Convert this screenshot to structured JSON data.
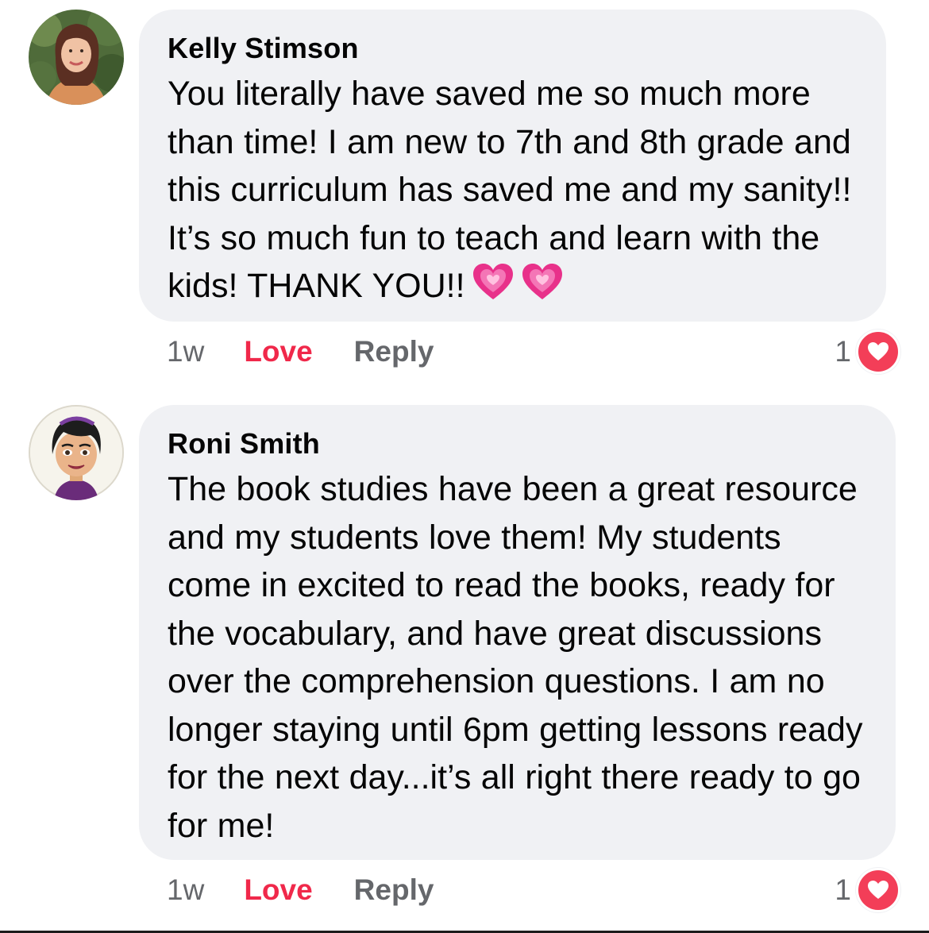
{
  "comments": [
    {
      "author": "Kelly Stimson",
      "text": "You literally have saved me so much more than time! I am new to 7th and 8th grade and this curriculum has saved me and my sanity!! It’s so much fun to teach and learn with the kids! THANK YOU!!",
      "emoji": [
        "growing-heart-icon",
        "growing-heart-icon"
      ],
      "time": "1w",
      "love_label": "Love",
      "reply_label": "Reply",
      "reaction_count": "1",
      "reaction_icon": "heart-icon"
    },
    {
      "author": "Roni Smith",
      "text": "The book studies have been a great resource and my students love them! My students come in excited to read the books, ready for the vocabulary, and have great discussions over the comprehension questions. I am no longer staying until 6pm getting lessons ready for the next day...it’s all right there ready to go for me!",
      "time": "1w",
      "love_label": "Love",
      "reply_label": "Reply",
      "reaction_count": "1",
      "reaction_icon": "heart-icon"
    }
  ],
  "colors": {
    "bubble": "#f0f1f4",
    "love_accent": "#f0284a",
    "heart_badge": "#f33e58",
    "meta_text": "#65676b"
  }
}
